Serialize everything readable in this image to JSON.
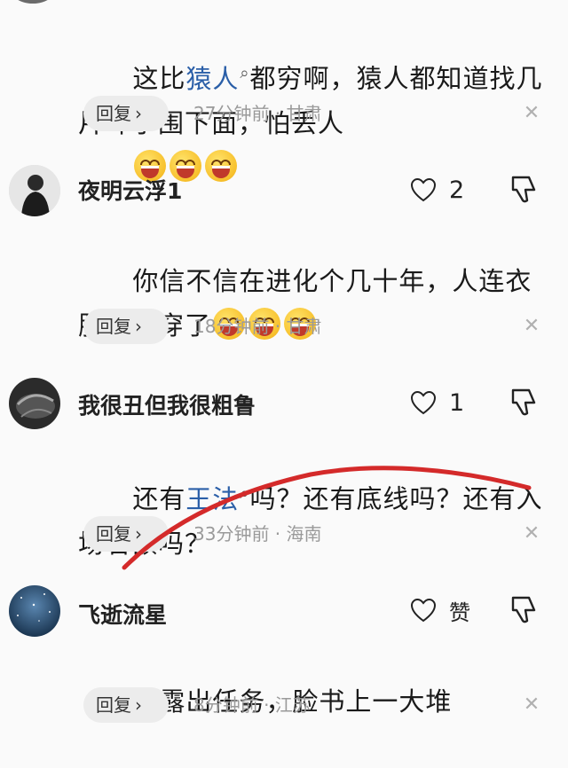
{
  "comments": [
    {
      "text_part1": "这比",
      "text_highlight": "猿人",
      "text_part2": "都穷啊，猿人都知道找几片叶子围下面，怕丢人",
      "emoji_icon": "grinning-squint-emoji",
      "reply_label": "回复",
      "time_location": "27分钟前 · 甘肃",
      "close_glyph": "✕"
    },
    {
      "username": "夜明云浮1",
      "likes": "2",
      "text": "你信不信在进化个几十年，人连衣服都不穿了",
      "emoji_icon": "laughing-emoji",
      "reply_label": "回复",
      "time_location": "18分钟前 · 甘肃",
      "close_glyph": "✕"
    },
    {
      "username": "我很丑但我很粗鲁",
      "likes": "1",
      "text_part1": "还有",
      "text_highlight": "王法",
      "text_part2": "吗？还有底线吗？还有入场名额吗？",
      "reply_label": "回复",
      "time_location": "33分钟前 · 海南",
      "close_glyph": "✕"
    },
    {
      "username": "飞逝流星",
      "likes": "赞",
      "text": "是露出任务，脸书上一大堆",
      "reply_label": "回复",
      "time_location": "8分钟前 · 江苏",
      "close_glyph": "✕"
    }
  ],
  "colors": {
    "highlight": "#2b5fa8",
    "annotation_stroke": "#d42a2a",
    "reply_bg": "#ececec"
  }
}
